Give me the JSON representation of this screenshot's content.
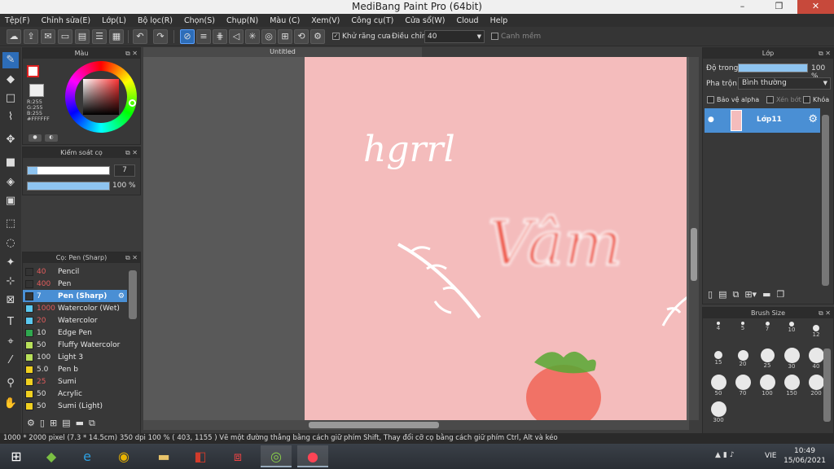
{
  "window": {
    "title": "MediBang Paint Pro (64bit)",
    "minimize": "–",
    "maximize": "❐",
    "close": "✕"
  },
  "menu": [
    "Tệp(F)",
    "Chỉnh sửa(E)",
    "Lớp(L)",
    "Bộ lọc(R)",
    "Chọn(S)",
    "Chụp(N)",
    "Màu (C)",
    "Xem(V)",
    "Công cụ(T)",
    "Cửa sổ(W)",
    "Cloud",
    "Help"
  ],
  "toolbar": {
    "antialias_label": "Khử răng cưa",
    "adjust_label": "Điều chỉnh",
    "adjust_value": "40",
    "edge_label": "Canh mềm"
  },
  "color_panel": {
    "title": "Màu",
    "r": "R:255",
    "g": "G:255",
    "b": "B:255",
    "hex": "#FFFFFF"
  },
  "brush_control": {
    "title": "Kiểm soát cọ",
    "size_value": "7",
    "opacity_value": "100 %"
  },
  "brush_panel": {
    "title": "Cọ: Pen (Sharp)",
    "items": [
      {
        "size": "40",
        "name": "Pencil",
        "color": "#333333"
      },
      {
        "size": "400",
        "name": "Pen",
        "color": "#333333"
      },
      {
        "size": "7",
        "name": "Pen (Sharp)",
        "color": "#333333",
        "selected": true
      },
      {
        "size": "1000",
        "name": "Watercolor (Wet)",
        "color": "#5bc8ef"
      },
      {
        "size": "20",
        "name": "Watercolor",
        "color": "#5bc8ef"
      },
      {
        "size": "10",
        "name": "Edge Pen",
        "color": "#2fa84f"
      },
      {
        "size": "50",
        "name": "Fluffy Watercolor",
        "color": "#b8e05a"
      },
      {
        "size": "100",
        "name": "Light 3",
        "color": "#b8e05a"
      },
      {
        "size": "5.0",
        "name": "Pen b",
        "color": "#f0d020"
      },
      {
        "size": "25",
        "name": "Sumi",
        "color": "#f0d020"
      },
      {
        "size": "50",
        "name": "Acrylic",
        "color": "#f0d020"
      },
      {
        "size": "50",
        "name": "Sumi (Light)",
        "color": "#f0d020"
      }
    ]
  },
  "canvas": {
    "tab_title": "Untitled",
    "text_sketch": "hgrrl",
    "text_word": "Vâm"
  },
  "layer_panel": {
    "title": "Lớp",
    "opacity_label": "Độ trong",
    "opacity_value": "100 %",
    "opacity_fraction": 1.0,
    "blend_label": "Pha trộn",
    "blend_value": "Bình thường",
    "protect_alpha": "Bảo vệ alpha",
    "clipping": "Xén bớt",
    "lock": "Khóa",
    "layer_name": "Lớp11"
  },
  "brush_size_panel": {
    "title": "Brush Size",
    "sizes": [
      "4",
      "5",
      "7",
      "10",
      "12",
      "15",
      "20",
      "25",
      "30",
      "40",
      "50",
      "70",
      "100",
      "150",
      "200",
      "300"
    ]
  },
  "status": {
    "text": "1000 * 2000 pixel   (7.3 * 14.5cm)  350 dpi  100 %   ( 403, 1155 )  Vẽ một đường thẳng bằng cách giữ phím Shift, Thay đổi cỡ cọ bằng cách giữ phím Ctrl, Alt và kéo"
  },
  "taskbar": {
    "lang": "VIE",
    "time": "10:49",
    "date": "15/06/2021"
  }
}
